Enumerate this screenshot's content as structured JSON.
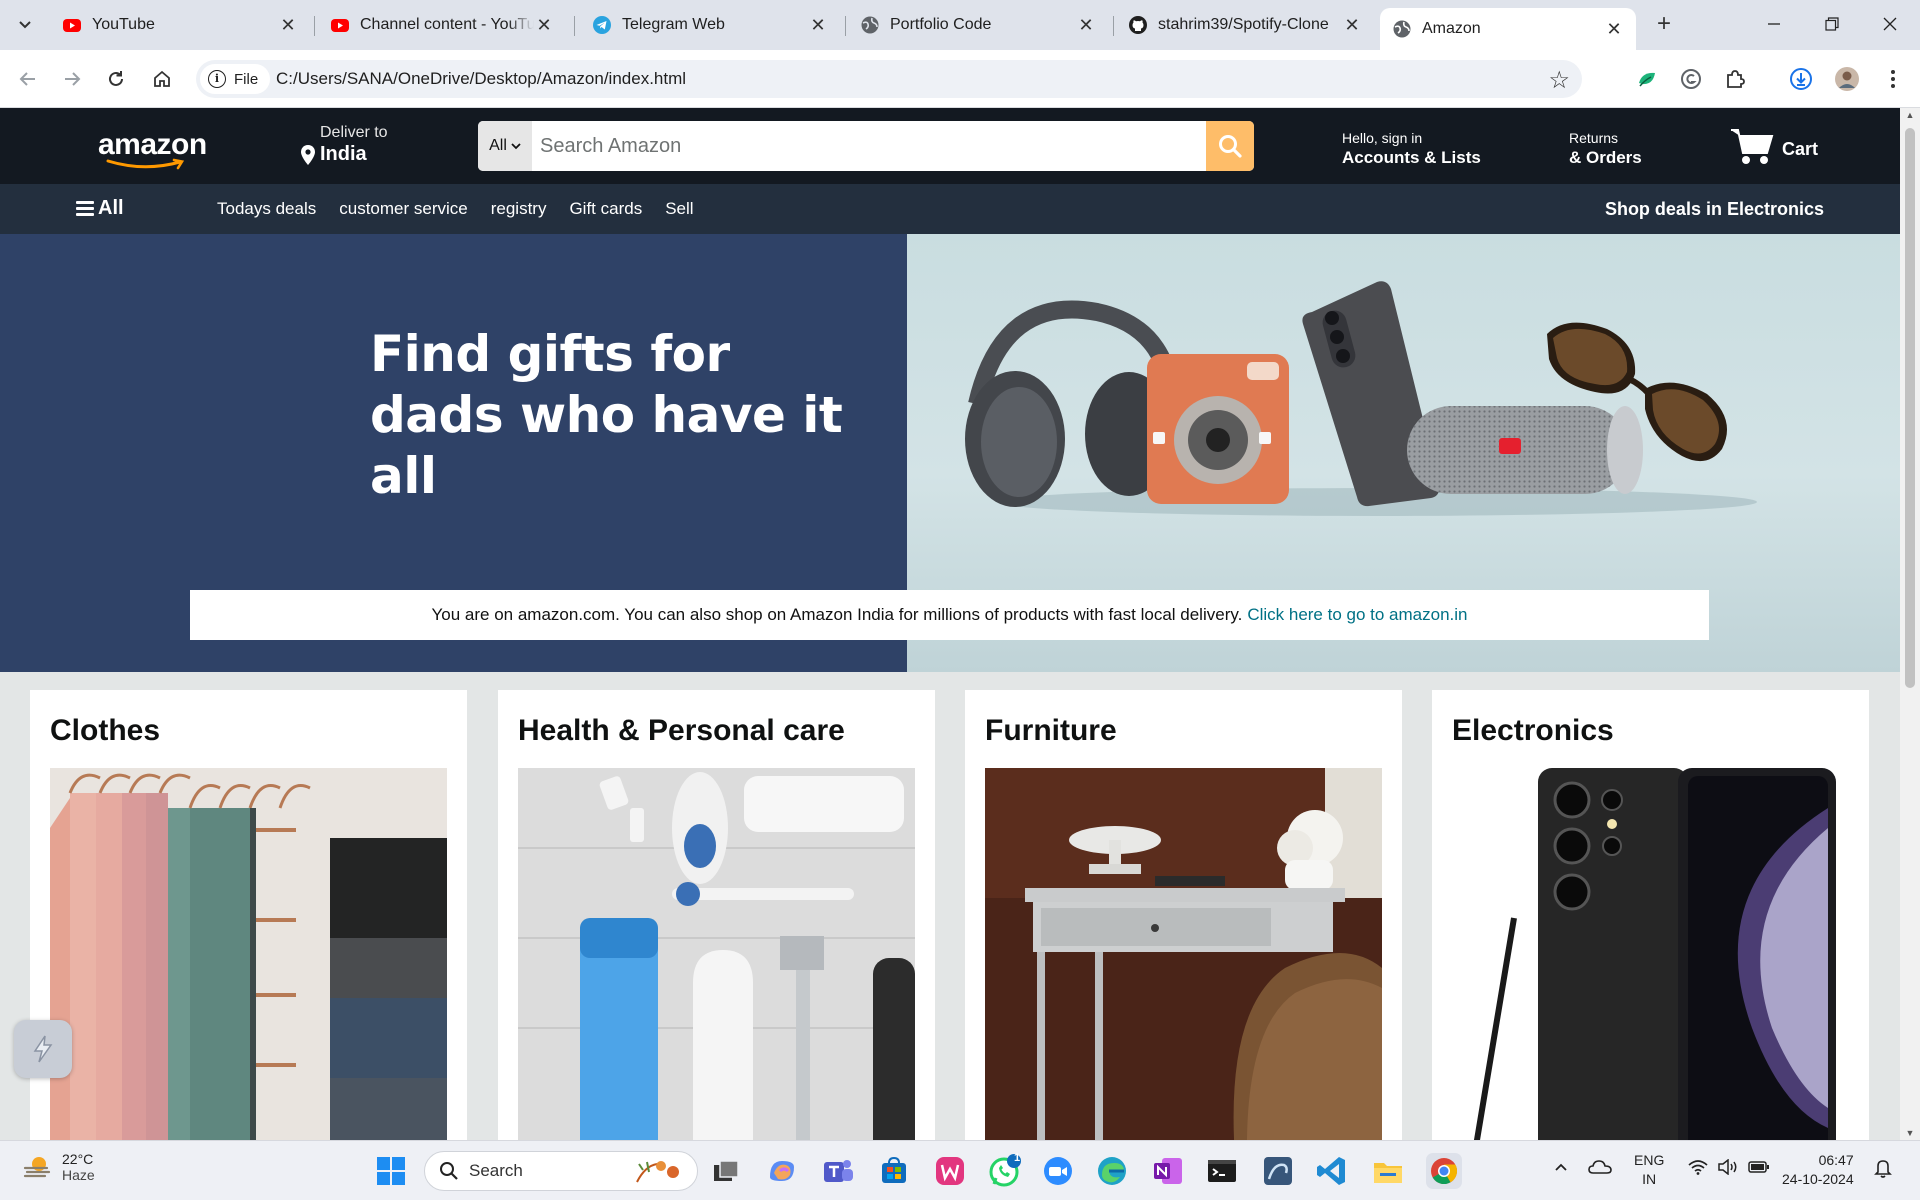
{
  "browser": {
    "tabs": [
      {
        "title": "YouTube",
        "icon": "youtube-icon"
      },
      {
        "title": "Channel content - YouTube",
        "icon": "youtube-icon"
      },
      {
        "title": "Telegram Web",
        "icon": "telegram-icon"
      },
      {
        "title": "Portfolio Code",
        "icon": "globe-icon"
      },
      {
        "title": "stahrim39/Spotify-Clone",
        "icon": "github-icon"
      },
      {
        "title": "Amazon",
        "icon": "globe-icon"
      }
    ],
    "close_glyph": "✕",
    "new_tab_glyph": "+",
    "address": {
      "chip_label": "File",
      "url": "C:/Users/SANA/OneDrive/Desktop/Amazon/index.html"
    }
  },
  "amazon": {
    "logo": "amazon",
    "deliver": {
      "small": "Deliver to",
      "big": "India"
    },
    "search": {
      "category": "All",
      "placeholder": "Search Amazon"
    },
    "account": {
      "small": "Hello, sign in",
      "big": "Accounts & Lists"
    },
    "returns": {
      "small": "Returns",
      "big": "& Orders"
    },
    "cart": {
      "label": "Cart"
    },
    "subnav": {
      "all": "All",
      "links": [
        "Todays deals",
        "customer service",
        "registry",
        "Gift cards",
        "Sell"
      ],
      "deals": "Shop deals in Electronics"
    },
    "hero": {
      "line1": "Find gifts for",
      "line2": "dads who have it all"
    },
    "notice": {
      "text": "You are on amazon.com. You can also shop on Amazon India for millions of products with fast local delivery.",
      "link": "Click here to go to amazon.in"
    },
    "cards": [
      {
        "title": "Clothes"
      },
      {
        "title": "Health & Personal care"
      },
      {
        "title": "Furniture"
      },
      {
        "title": "Electronics"
      }
    ],
    "colors": {
      "nav_top": "#131921",
      "nav_sub": "#232f3e",
      "hero_left": "#2f4267",
      "search_button": "#febd69",
      "link": "#007185"
    }
  },
  "taskbar": {
    "weather": {
      "temp": "22°C",
      "condition": "Haze"
    },
    "search_placeholder": "Search",
    "lang": {
      "line1": "ENG",
      "line2": "IN"
    },
    "clock": {
      "time": "06:47",
      "date": "24-10-2024"
    },
    "whatsapp_badge": "1"
  }
}
